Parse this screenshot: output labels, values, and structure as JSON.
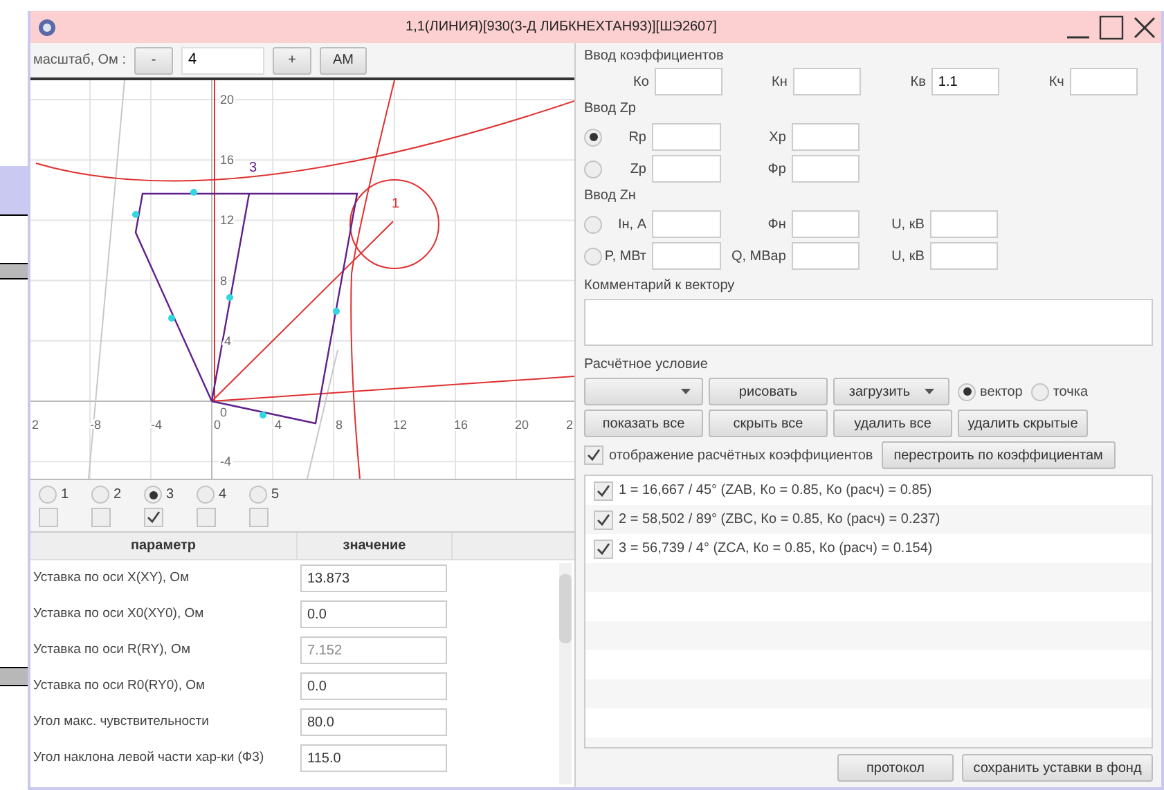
{
  "window": {
    "title": "1,1(ЛИНИЯ)[930(3-Д ЛИБКНЕХТАН93)][ШЭ2607]"
  },
  "scale_bar": {
    "label": "масштаб, Ом :",
    "minus": "-",
    "value": "4",
    "plus": "+",
    "auto": "AM"
  },
  "diagram": {
    "x_ticks": [
      "2",
      "-8",
      "-4",
      "0",
      "4",
      "8",
      "12",
      "16",
      "20",
      "2"
    ],
    "y_ticks": [
      "20",
      "16",
      "12",
      "8",
      "4",
      "0",
      "-4"
    ],
    "curve_labels": [
      "3",
      "1"
    ]
  },
  "curve_radios": [
    {
      "label": "1",
      "selected": false
    },
    {
      "label": "2",
      "selected": false
    },
    {
      "label": "3",
      "selected": true
    },
    {
      "label": "4",
      "selected": false
    },
    {
      "label": "5",
      "selected": false
    }
  ],
  "curve_checks": [
    {
      "checked": false
    },
    {
      "checked": false
    },
    {
      "checked": true
    },
    {
      "checked": false
    },
    {
      "checked": false
    }
  ],
  "parameters": {
    "columns": [
      "параметр",
      "значение"
    ],
    "rows": [
      {
        "name": "Уставка по оси X(XY), Ом",
        "value": "13.873",
        "disabled": false
      },
      {
        "name": "Уставка по оси X0(XY0), Ом",
        "value": "0.0",
        "disabled": false
      },
      {
        "name": "Уставка по оси R(RY), Ом",
        "value": "7.152",
        "disabled": true
      },
      {
        "name": "Уставка по оси R0(RY0), Ом",
        "value": "0.0",
        "disabled": false
      },
      {
        "name": "Угол макс. чувствительности",
        "value": "80.0",
        "disabled": false
      },
      {
        "name": "Угол наклона левой части хар-ки (Ф3)",
        "value": "115.0",
        "disabled": false
      }
    ]
  },
  "coefficients": {
    "title": "Ввод коэффициентов",
    "fields": [
      {
        "label": "Ко"
      },
      {
        "label": "Кн"
      },
      {
        "label": "Кв",
        "value": "1.1"
      },
      {
        "label": "Кч"
      }
    ]
  },
  "zr": {
    "title": "Ввод Zр",
    "rows": [
      {
        "selected": true,
        "fields": [
          {
            "label": "Rр"
          },
          {
            "label": "Хр"
          }
        ]
      },
      {
        "selected": false,
        "fields": [
          {
            "label": "Zр"
          },
          {
            "label": "Фр"
          }
        ]
      }
    ]
  },
  "zn": {
    "title": "Ввод Zн",
    "rows": [
      {
        "selected": false,
        "fields": [
          {
            "label": "Iн, А"
          },
          {
            "label": "Фн"
          },
          {
            "label": "U, кВ"
          }
        ]
      },
      {
        "selected": false,
        "fields": [
          {
            "label": "P, МВт"
          },
          {
            "label": "Q, МВар"
          },
          {
            "label": "U, кВ"
          }
        ]
      }
    ]
  },
  "comment": {
    "label": "Комментарий к вектору"
  },
  "calc": {
    "label": "Расчётное условие",
    "draw_button": "рисовать",
    "load_button": "загрузить",
    "modes": [
      {
        "label": "вектор",
        "selected": true
      },
      {
        "label": "точка",
        "selected": false
      }
    ],
    "buttons": [
      "показать все",
      "скрыть все",
      "удалить все",
      "удалить скрытые"
    ],
    "show_coeffs": {
      "label": "отображение расчётных коэффициентов",
      "checked": true
    },
    "rebuild_button": "перестроить по коэффициентам"
  },
  "vectors": [
    {
      "text": "1 = 16,667 / 45°  (ZAB, Ко = 0.85, Ко (расч) = 0.85)",
      "checked": true
    },
    {
      "text": "2 = 58,502 / 89°  (ZBC, Ко = 0.85, Ко (расч) = 0.237)",
      "checked": true
    },
    {
      "text": "3 = 56,739 / 4°  (ZCA, Ко = 0.85, Ко (расч) = 0.154)",
      "checked": true
    }
  ],
  "footer_buttons": [
    "протокол",
    "сохранить уставки в фонд"
  ]
}
